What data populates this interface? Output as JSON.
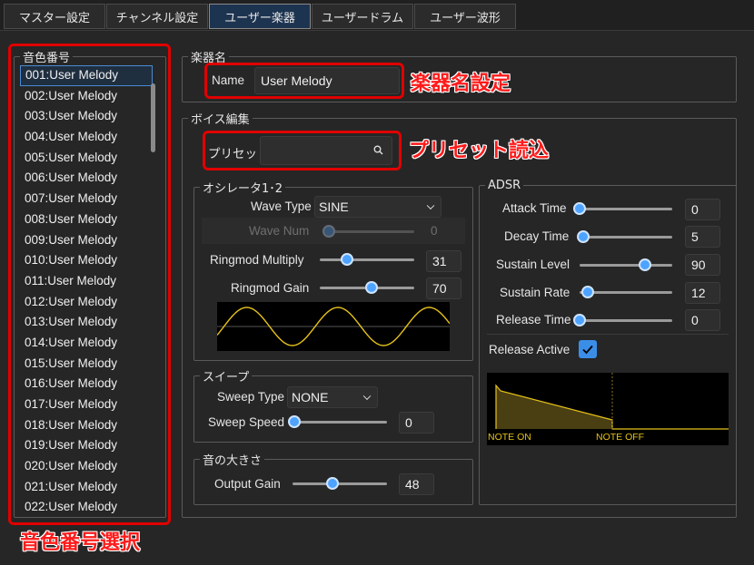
{
  "tabs": [
    "マスター設定",
    "チャンネル設定",
    "ユーザー楽器",
    "ユーザードラム",
    "ユーザー波形"
  ],
  "voice_list": {
    "legend": "音色番号",
    "items": [
      "001:User Melody",
      "002:User Melody",
      "003:User Melody",
      "004:User Melody",
      "005:User Melody",
      "006:User Melody",
      "007:User Melody",
      "008:User Melody",
      "009:User Melody",
      "010:User Melody",
      "011:User Melody",
      "012:User Melody",
      "013:User Melody",
      "014:User Melody",
      "015:User Melody",
      "016:User Melody",
      "017:User Melody",
      "018:User Melody",
      "019:User Melody",
      "020:User Melody",
      "021:User Melody",
      "022:User Melody"
    ],
    "selected_index": 0
  },
  "instrument_name": {
    "legend": "楽器名",
    "label": "Name",
    "value": "User Melody"
  },
  "voice_edit": {
    "legend": "ボイス編集",
    "preset_label": "プリセット",
    "preset_value": ""
  },
  "oscillator": {
    "legend": "オシレータ1･2",
    "wave_type_label": "Wave Type",
    "wave_type_value": "SINE",
    "wave_num_label": "Wave Num",
    "wave_num_value": "0",
    "wave_num_level": 0,
    "ringmod_multiply_label": "Ringmod Multiply",
    "ringmod_multiply_value": "31",
    "ringmod_multiply_level": 0.29,
    "ringmod_gain_label": "Ringmod Gain",
    "ringmod_gain_value": "70",
    "ringmod_gain_level": 0.55
  },
  "sweep": {
    "legend": "スイープ",
    "sweep_type_label": "Sweep Type",
    "sweep_type_value": "NONE",
    "sweep_speed_label": "Sweep Speed",
    "sweep_speed_value": "0",
    "sweep_speed_level": 0
  },
  "volume": {
    "legend": "音の大きさ",
    "output_gain_label": "Output Gain",
    "output_gain_value": "48",
    "output_gain_level": 0.42
  },
  "adsr": {
    "legend": "ADSR",
    "attack_label": "Attack Time",
    "attack_value": "0",
    "attack_level": 0,
    "decay_label": "Decay Time",
    "decay_value": "5",
    "decay_level": 0.04,
    "sustain_level_label": "Sustain Level",
    "sustain_level_value": "90",
    "sustain_level_level": 0.71,
    "sustain_rate_label": "Sustain Rate",
    "sustain_rate_value": "12",
    "sustain_rate_level": 0.09,
    "release_label": "Release Time",
    "release_value": "0",
    "release_level": 0,
    "release_active_label": "Release Active",
    "release_active_checked": true,
    "note_on_label": "NOTE ON",
    "note_off_label": "NOTE OFF"
  },
  "annotations": {
    "instrument_name": "楽器名設定",
    "preset_load": "プリセット読込",
    "voice_select": "音色番号選択"
  },
  "colors": {
    "accent": "#4da3ff",
    "annotation": "#ff1a1a",
    "waveform": "#e6c21a"
  }
}
